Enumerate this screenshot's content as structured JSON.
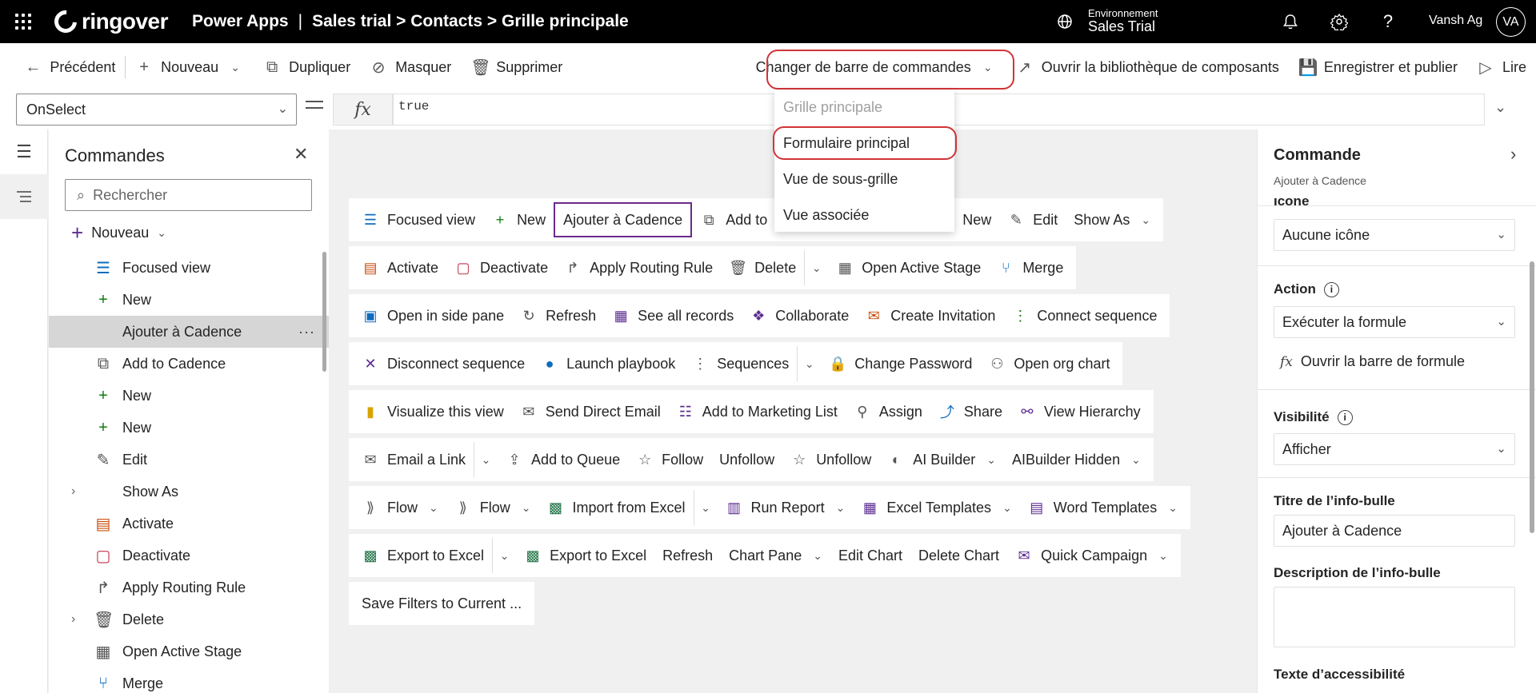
{
  "header": {
    "logo": "ringover",
    "app_name": "Power Apps",
    "separator": "|",
    "breadcrumb": "Sales trial > Contacts > Grille principale",
    "env_label": "Environnement",
    "env_name": "Sales Trial",
    "user_name": "Vansh Ag",
    "avatar_initials": "VA"
  },
  "commandbar": {
    "back": "Précédent",
    "new": "Nouveau",
    "duplicate": "Dupliquer",
    "hide": "Masquer",
    "delete": "Supprimer",
    "change_bar": "Changer de barre de commandes",
    "open_library": "Ouvrir la bibliothèque de composants",
    "save_publish": "Enregistrer et publier",
    "play": "Lire"
  },
  "formula": {
    "property": "OnSelect",
    "fx": "fx",
    "value": "true"
  },
  "dropdown": {
    "items": [
      "Grille principale",
      "Formulaire principal",
      "Vue de sous-grille",
      "Vue associée"
    ]
  },
  "left_panel": {
    "title": "Commandes",
    "search_placeholder": "Rechercher",
    "new_label": "Nouveau",
    "items": [
      "Focused view",
      "New",
      "Ajouter à Cadence",
      "Add to Cadence",
      "New",
      "New",
      "Edit",
      "Show As",
      "Activate",
      "Deactivate",
      "Apply Routing Rule",
      "Delete",
      "Open Active Stage",
      "Merge"
    ]
  },
  "canvas": {
    "row1": [
      "Focused view",
      "New",
      "Ajouter à Cadence",
      "Add to",
      "New",
      "Edit",
      "Show As"
    ],
    "row2": [
      "Activate",
      "Deactivate",
      "Apply Routing Rule",
      "Delete",
      "Open Active Stage",
      "Merge"
    ],
    "row3": [
      "Open in side pane",
      "Refresh",
      "See all records",
      "Collaborate",
      "Create Invitation",
      "Connect sequence"
    ],
    "row4": [
      "Disconnect sequence",
      "Launch playbook",
      "Sequences",
      "Change Password",
      "Open org chart"
    ],
    "row5": [
      "Visualize this view",
      "Send Direct Email",
      "Add to Marketing List",
      "Assign",
      "Share",
      "View Hierarchy"
    ],
    "row6": [
      "Email a Link",
      "Add to Queue",
      "Follow",
      "Unfollow",
      "Unfollow",
      "AI Builder",
      "AIBuilder Hidden"
    ],
    "row7": [
      "Flow",
      "Flow",
      "Import from Excel",
      "Run Report",
      "Excel Templates",
      "Word Templates"
    ],
    "row8": [
      "Export to Excel",
      "Export to Excel",
      "Refresh",
      "Chart Pane",
      "Edit Chart",
      "Delete Chart",
      "Quick Campaign"
    ],
    "row9": [
      "Save Filters to Current ..."
    ]
  },
  "right_panel": {
    "title": "Commande",
    "subtitle": "Ajouter à Cadence",
    "icon_label": "Icône",
    "icon_value": "Aucune icône",
    "action_label": "Action",
    "action_value": "Exécuter la formule",
    "open_formula": "Ouvrir la barre de formule",
    "visibility_label": "Visibilité",
    "visibility_value": "Afficher",
    "tooltip_title_label": "Titre de l’info-bulle",
    "tooltip_title_value": "Ajouter à Cadence",
    "tooltip_desc_label": "Description de l’info-bulle",
    "accessibility_label": "Texte d’accessibilité"
  },
  "colors": {
    "highlight": "#d13438",
    "selected_border": "#6b2a8c",
    "accent": "#5c2d91"
  }
}
